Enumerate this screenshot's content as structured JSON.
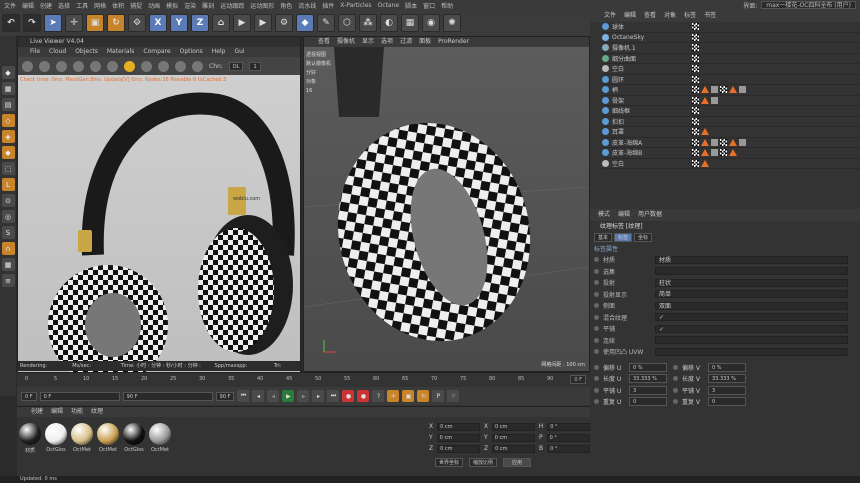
{
  "menubar": {
    "items": [
      "文件",
      "编辑",
      "创建",
      "选择",
      "工具",
      "网格",
      "体积",
      "捕捉",
      "动画",
      "模拟",
      "渲染",
      "雕刻",
      "运动跟踪",
      "运动图形",
      "角色",
      "流水线",
      "插件",
      "X-Particles",
      "Octane",
      "脚本",
      "窗口",
      "帮助"
    ],
    "layout_label": "界面:",
    "layout_value": "max一楼花-OC四科全布 (用户)"
  },
  "toolbar": {
    "axes": [
      "X",
      "Y",
      "Z"
    ]
  },
  "live_viewer": {
    "title": "Live Viewer V4.04",
    "menu": [
      "File",
      "Cloud",
      "Objects",
      "Materials",
      "Compare",
      "Options",
      "Help",
      "Gui"
    ],
    "chn_label": "Chn:",
    "chn_value": "DL",
    "chn_num": "1",
    "warning": "Check time: 0ms. MeshGen:8ms. Update[V] 0ms. Nodes:16 Movable:9 txCached:3",
    "status": {
      "rendering": "Rendering: 62.5%",
      "ms": "Ms/sec: 141.597",
      "time": "Time: 小时 : 分钟 : 秒/小时 : 分钟 : 秒",
      "spp": "Spp/maxspp: 80/128",
      "tri": "Tri: 0/310k"
    },
    "brand": "wobiu.com"
  },
  "viewport": {
    "menu": [
      "查看",
      "摄像机",
      "显示",
      "选项",
      "过滤",
      "面板",
      "ProRender"
    ],
    "info": [
      "透视视图",
      "默认摄像机",
      "分好",
      "对象",
      "16"
    ],
    "grid": "网格间距 : 100 cm"
  },
  "object_manager": {
    "menu": [
      "文件",
      "编辑",
      "查看",
      "对象",
      "标签",
      "书签"
    ],
    "rows": [
      {
        "name": "球体",
        "color": "#5a9ad5"
      },
      {
        "name": "OctaneSky",
        "color": "#7fb0e0"
      },
      {
        "name": "摄像机.1",
        "color": "#8ab"
      },
      {
        "name": "细分曲面",
        "color": "#6a8"
      },
      {
        "name": "空白",
        "color": "#bbb"
      },
      {
        "name": "圆环",
        "color": "#5a9ad5"
      },
      {
        "name": "柄",
        "color": "#5a9ad5"
      },
      {
        "name": "骨架",
        "color": "#5a9ad5"
      },
      {
        "name": "细线框",
        "color": "#5a9ad5"
      },
      {
        "name": "扣扣",
        "color": "#5a9ad5"
      },
      {
        "name": "耳罩",
        "color": "#5a9ad5"
      },
      {
        "name": "皮革-海绵A",
        "color": "#5a9ad5"
      },
      {
        "name": "皮革-海绵B",
        "color": "#5a9ad5"
      },
      {
        "name": "空白",
        "color": "#bbb"
      }
    ]
  },
  "attributes": {
    "menu": [
      "模式",
      "编辑",
      "用户数据"
    ],
    "title": "纹理标签 [纹理]",
    "tabs": [
      "基本",
      "标签",
      "坐标"
    ],
    "section": "标签属性",
    "rows": [
      {
        "label": "材质",
        "value": "材质"
      },
      {
        "label": "选集",
        "value": ""
      },
      {
        "label": "投射",
        "value": "柱状"
      },
      {
        "label": "投射显示",
        "value": "简单"
      },
      {
        "label": "侧面",
        "value": "双面"
      },
      {
        "label": "混合纹理",
        "value": "✓"
      },
      {
        "label": "平铺",
        "value": "✓"
      },
      {
        "label": "连续",
        "value": ""
      },
      {
        "label": "使用凹凸 UVW",
        "value": ""
      }
    ],
    "uv": [
      {
        "l1": "偏移 U",
        "v1": "0 %",
        "l2": "偏移 V",
        "v2": "0 %"
      },
      {
        "l1": "长度 U",
        "v1": "33.333 %",
        "l2": "长度 V",
        "v2": "33.333 %"
      },
      {
        "l1": "平铺 U",
        "v1": "3",
        "l2": "平铺 V",
        "v2": "3"
      },
      {
        "l1": "重复 U",
        "v1": "0",
        "l2": "重复 V",
        "v2": "0"
      }
    ]
  },
  "timeline": {
    "ticks": [
      "0",
      "5",
      "10",
      "15",
      "20",
      "25",
      "30",
      "35",
      "40",
      "45",
      "50",
      "55",
      "60",
      "65",
      "70",
      "75",
      "80",
      "85",
      "90"
    ],
    "frame_start": "0 F",
    "frame_cur": "0 F",
    "frame_end": "90 F",
    "frame_end2": "90 F",
    "frame_right": "0 F"
  },
  "materials": {
    "menu": [
      "创建",
      "编辑",
      "功能",
      "纹理"
    ],
    "items": [
      {
        "name": "材质",
        "color": "#222"
      },
      {
        "name": "OctGlos",
        "color": "#eee"
      },
      {
        "name": "OctMet",
        "color": "#d9c08a"
      },
      {
        "name": "OctMet",
        "color": "#c9a050"
      },
      {
        "name": "OctGlos",
        "color": "#111"
      },
      {
        "name": "OctMet",
        "color": "#999"
      }
    ]
  },
  "coordinates": {
    "rows": [
      [
        "X",
        "0 cm",
        "X",
        "0 cm",
        "H",
        "0 °"
      ],
      [
        "Y",
        "0 cm",
        "Y",
        "0 cm",
        "P",
        "0 °"
      ],
      [
        "Z",
        "0 cm",
        "Z",
        "0 cm",
        "B",
        "0 °"
      ]
    ],
    "mode1": "世界坐标",
    "mode2": "缩放比例",
    "apply": "应用"
  },
  "status": "Updated: 0 ms"
}
